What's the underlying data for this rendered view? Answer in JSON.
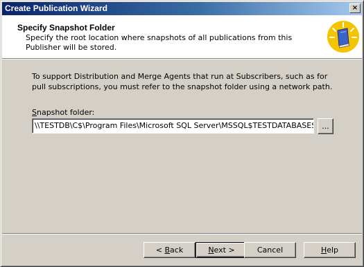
{
  "window": {
    "title": "Create Publication Wizard",
    "close_glyph": "×"
  },
  "header": {
    "title": "Specify Snapshot Folder",
    "description": "Specify the root location where snapshots of all publications from this Publisher will be stored.",
    "icon": "wizard-book-icon"
  },
  "body": {
    "intro": "To support Distribution and Merge Agents that run at Subscribers, such as for pull subscriptions, you must refer to the snapshot folder using a network path.",
    "snapshot_label_accel": "S",
    "snapshot_label_rest": "napshot folder:",
    "snapshot_path": "\\\\TESTDB\\C$\\Program Files\\Microsoft SQL Server\\MSSQL$TESTDATABASESQ",
    "browse_label": "..."
  },
  "footer": {
    "back_prefix": "< ",
    "back_accel": "B",
    "back_rest": "ack",
    "next_accel": "N",
    "next_rest": "ext >",
    "cancel_label": "Cancel",
    "help_accel": "H",
    "help_rest": "elp"
  },
  "colors": {
    "title_bar_start": "#0a246a",
    "title_bar_end": "#a6caf0",
    "dialog_face": "#d4d0c8",
    "icon_circle": "#f5c400"
  }
}
